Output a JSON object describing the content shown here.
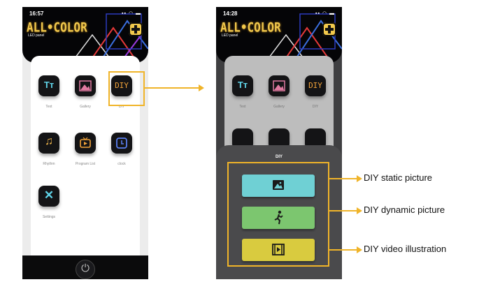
{
  "left_phone": {
    "status_time": "16:57",
    "status_icons": "▪▪ ◠ ▬",
    "logo": "ALL•COLOR",
    "sublogo": "LED panel",
    "apps": [
      {
        "label": "Text",
        "glyph": "Tт"
      },
      {
        "label": "Gallery",
        "glyph": ""
      },
      {
        "label": "DIY",
        "glyph": "DIY"
      },
      {
        "label": "Rhythm",
        "glyph": "♫"
      },
      {
        "label": "Program List",
        "glyph": ""
      },
      {
        "label": "clock",
        "glyph": ""
      },
      {
        "label": "Settings",
        "glyph": "✕"
      }
    ],
    "power_glyph": "⏻"
  },
  "right_phone": {
    "status_time": "14:28",
    "status_icons": "▪▪ ◠ ▬",
    "logo": "ALL•COLOR",
    "sublogo": "LED panel",
    "apps": [
      {
        "label": "Text",
        "glyph": "Tт"
      },
      {
        "label": "Gallery",
        "glyph": ""
      },
      {
        "label": "DIY",
        "glyph": "DIY"
      }
    ],
    "sheet_title": "DIY",
    "options": [
      {
        "name": "static",
        "color": "#6fd0d4",
        "icon": "image-icon"
      },
      {
        "name": "dynamic",
        "color": "#7cc66f",
        "icon": "running-person-icon"
      },
      {
        "name": "video",
        "color": "#d9cb3f",
        "icon": "film-icon"
      }
    ]
  },
  "callouts": [
    "DIY static picture",
    "DIY dynamic picture",
    "DIY video illustration"
  ],
  "colors": {
    "highlight": "#f0b429",
    "logo": "#f2c94c",
    "header_bg": "#050507"
  }
}
